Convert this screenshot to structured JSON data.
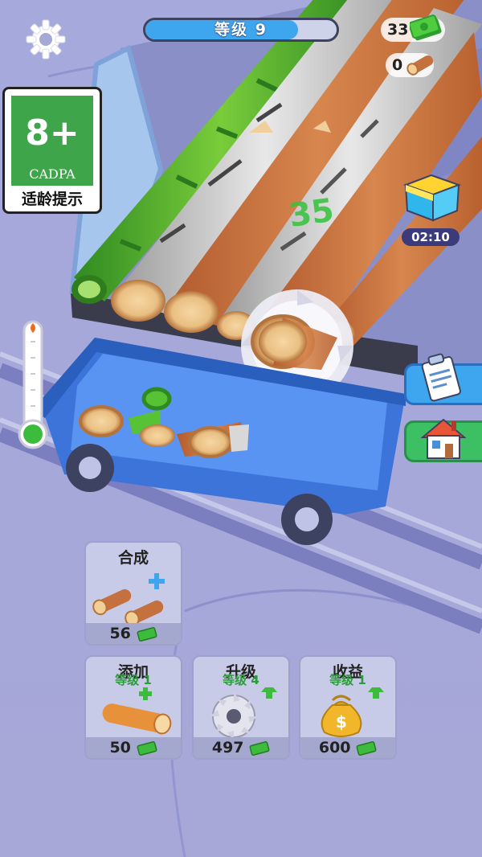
{
  "hud": {
    "level_label": "等级 9",
    "level_progress": 0.8,
    "cash": "33",
    "logs": "0"
  },
  "rating": {
    "age": "8+",
    "org": "CADPA",
    "hint": "适龄提示"
  },
  "floating_text": "35",
  "chest_timer": "02:10",
  "cards": {
    "merge": {
      "title": "合成",
      "price": "56"
    },
    "add": {
      "title": "添加",
      "level": "等级 1",
      "price": "50"
    },
    "upgrade": {
      "title": "升级",
      "level": "等级 4",
      "price": "497"
    },
    "income": {
      "title": "收益",
      "level": "等级 1",
      "price": "600"
    }
  },
  "colors": {
    "money": "#3dbb3d",
    "wood": "#c4703f",
    "accent": "#3ea6ef"
  }
}
